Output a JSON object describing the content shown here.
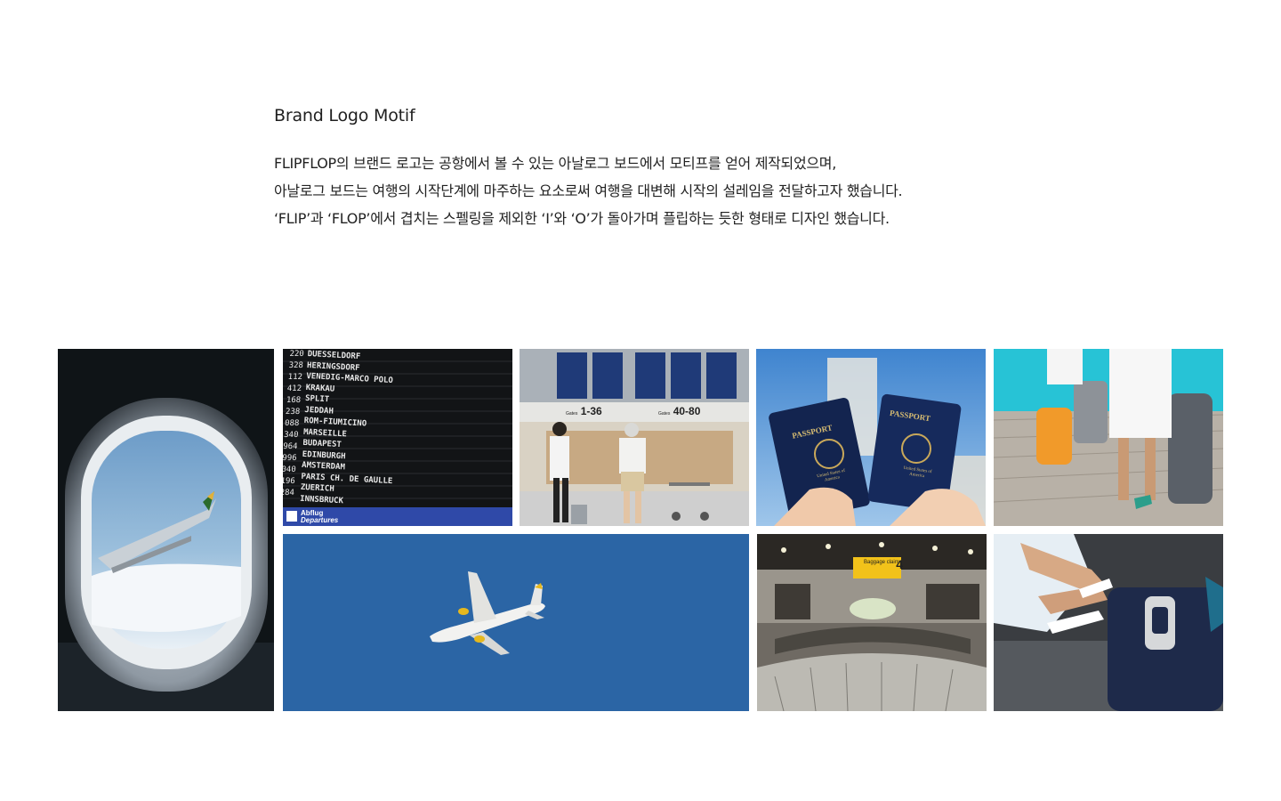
{
  "section": {
    "title": "Brand Logo Motif",
    "description": [
      "FLIPFLOP의 브랜드 로고는 공항에서 볼 수 있는 아날로그 보드에서 모티프를 얻어 제작되었으며,",
      "아날로그 보드는 여행의 시작단계에 마주하는 요소로써 여행을 대변해 시작의 설레임을 전달하고자 했습니다.",
      "‘FLIP’과 ‘FLOP’에서 겹치는 스펠링을 제외한 ‘I’와 ‘O’가 돌아가며 플립하는 듯한 형태로 디자인 했습니다."
    ]
  },
  "gallery": {
    "board": {
      "codes": [
        "220",
        "328",
        "112",
        "412",
        "168",
        "238",
        "088",
        "340",
        "964",
        "996",
        "040",
        "196",
        "284"
      ],
      "cities": [
        "DUESSELDORF",
        "HERINGSDORF",
        "VENEDIG-MARCO POLO",
        "KRAKAU",
        "SPLIT",
        "JEDDAH",
        "ROM-FIUMICINO",
        "MARSEILLE",
        "BUDAPEST",
        "EDINBURGH",
        "AMSTERDAM",
        "PARIS CH. DE GAULLE",
        "ZUERICH",
        "INNSBRUCK"
      ],
      "sign_top": "Abflug",
      "sign_bottom": "Departures"
    },
    "terminal": {
      "gate_left": "1-36",
      "gate_right": "40-80",
      "gates_word": "Gates"
    },
    "passport": {
      "label": "PASSPORT",
      "country": "United States of America"
    },
    "baggage": {
      "sign_label": "Baggage claim",
      "sign_number": "4"
    }
  }
}
